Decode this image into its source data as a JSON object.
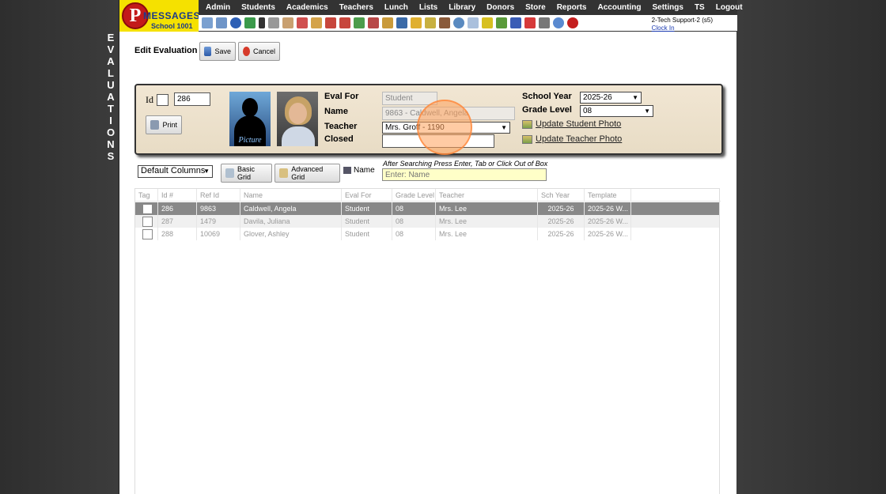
{
  "side_label_letters": [
    "E",
    "V",
    "A",
    "L",
    "U",
    "A",
    "T",
    "I",
    "O",
    "N",
    "S"
  ],
  "logo": {
    "letter": "P",
    "word": "MESSAGES",
    "school": "School 1001"
  },
  "menu": [
    "Admin",
    "Students",
    "Academics",
    "Teachers",
    "Lunch",
    "Lists",
    "Library",
    "Donors",
    "Store",
    "Reports",
    "Accounting",
    "Settings",
    "TS",
    "Logout"
  ],
  "toolbar_icons": [
    "search-icon",
    "grid-icon",
    "at-icon",
    "chat-icon",
    "phone-icon",
    "speaker-icon",
    "list-icon",
    "calendar-icon",
    "megaphone-icon",
    "person-icon",
    "person-icon",
    "money-icon",
    "people-icon",
    "card-icon",
    "book-icon",
    "pencil-icon",
    "arrow-icon",
    "users-icon",
    "gear-icon",
    "form-icon",
    "bus-icon",
    "chart-icon",
    "aplus-icon",
    "pdf-icon",
    "camera-icon",
    "help-icon",
    "power-icon"
  ],
  "user": {
    "name": "2-Tech Support-2 (s5)",
    "clock": "Clock In"
  },
  "page": {
    "title": "Edit Evaluation",
    "save_label": "Save",
    "cancel_label": "Cancel"
  },
  "form": {
    "id_label": "Id",
    "id_value": "286",
    "print_label": "Print",
    "photo_caption": "Picture",
    "eval_for_label": "Eval For",
    "eval_for_value": "Student",
    "name_label": "Name",
    "name_value": "9863 - Caldwell, Angela",
    "teacher_label": "Teacher",
    "teacher_value": "Mrs. Groff - 1190",
    "closed_label": "Closed",
    "closed_value": "",
    "school_year_label": "School Year",
    "school_year_value": "2025-26",
    "grade_level_label": "Grade Level",
    "grade_level_value": "08",
    "update_student_photo": "Update Student Photo",
    "update_teacher_photo": "Update Teacher Photo"
  },
  "search": {
    "columns_select": "Default Columns",
    "basic_grid": "Basic Grid",
    "advanced_grid": "Advanced Grid",
    "name_label": "Name",
    "hint": "After Searching Press Enter, Tab or Click Out of Box",
    "placeholder": "Enter: Name"
  },
  "grid": {
    "headers": [
      "Tag",
      "Id #",
      "Ref Id",
      "Name",
      "Eval For",
      "Grade Level",
      "Teacher",
      "Sch Year",
      "Template"
    ],
    "rows": [
      {
        "id": "286",
        "ref": "9863",
        "name": "Caldwell, Angela",
        "eval_for": "Student",
        "grade": "08",
        "teacher": "Mrs. Lee",
        "year": "2025-26",
        "template": "2025-26 W..."
      },
      {
        "id": "287",
        "ref": "1479",
        "name": "Davila, Juliana",
        "eval_for": "Student",
        "grade": "08",
        "teacher": "Mrs. Lee",
        "year": "2025-26",
        "template": "2025-26 W..."
      },
      {
        "id": "288",
        "ref": "10069",
        "name": "Glover, Ashley",
        "eval_for": "Student",
        "grade": "08",
        "teacher": "Mrs. Lee",
        "year": "2025-26",
        "template": "2025-26 W..."
      }
    ]
  }
}
